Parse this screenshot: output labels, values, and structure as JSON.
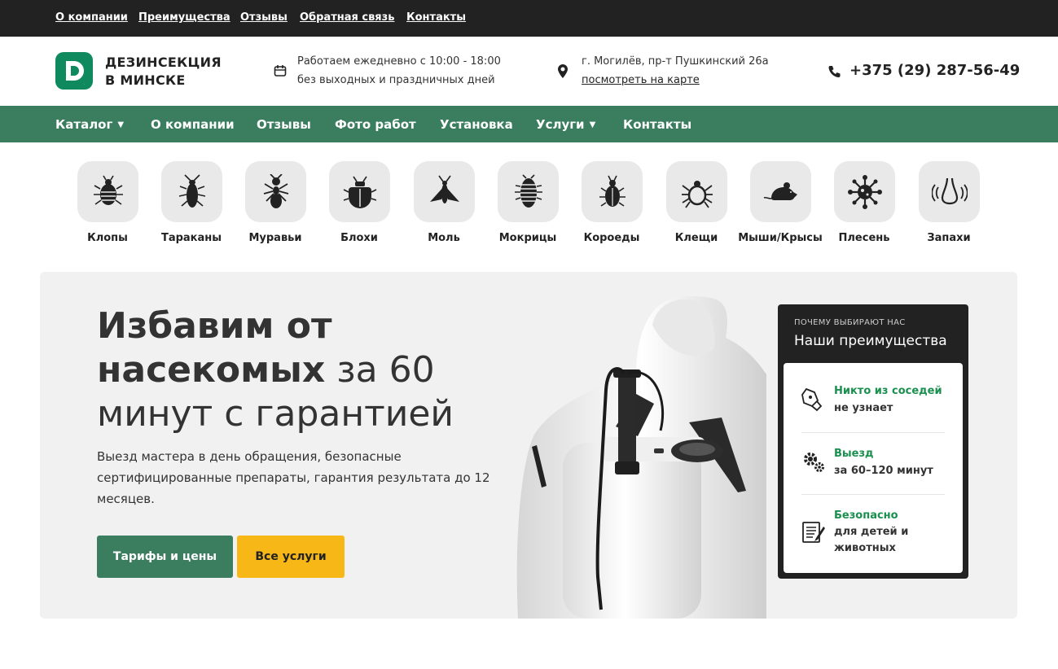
{
  "topnav": [
    "О компании",
    "Преимущества",
    "Отзывы",
    "Обратная связь",
    "Контакты"
  ],
  "header": {
    "logo_letter": "D",
    "logo_line1": "ДЕЗИНСЕКЦИЯ",
    "logo_line2": "В МИНСКЕ",
    "hours_line1": "Работаем ежедневно с 10:00 - 18:00",
    "hours_line2": "без выходных и праздничных дней",
    "address": "г. Могилёв, пр-т Пушкинский 26а",
    "map_link": "посмотреть на карте",
    "phone": "+375 (29) 287-56-49"
  },
  "mainnav": [
    {
      "label": "Каталог",
      "dropdown": true
    },
    {
      "label": "О компании",
      "dropdown": false
    },
    {
      "label": "Отзывы",
      "dropdown": false
    },
    {
      "label": "Фото работ",
      "dropdown": false
    },
    {
      "label": "Установка",
      "dropdown": false
    },
    {
      "label": "Услуги",
      "dropdown": true
    },
    {
      "label": "Контакты",
      "dropdown": false
    }
  ],
  "categories": [
    {
      "label": "Клопы",
      "icon": "bedbug-icon"
    },
    {
      "label": "Тараканы",
      "icon": "cockroach-icon"
    },
    {
      "label": "Муравьи",
      "icon": "ant-icon"
    },
    {
      "label": "Блохи",
      "icon": "flea-icon"
    },
    {
      "label": "Моль",
      "icon": "moth-icon"
    },
    {
      "label": "Мокрицы",
      "icon": "woodlouse-icon"
    },
    {
      "label": "Короеды",
      "icon": "bark-beetle-icon"
    },
    {
      "label": "Клещи",
      "icon": "tick-icon"
    },
    {
      "label": "Мыши/Крысы",
      "icon": "rat-icon"
    },
    {
      "label": "Плесень",
      "icon": "mold-icon"
    },
    {
      "label": "Запахи",
      "icon": "smell-icon"
    }
  ],
  "hero": {
    "title_bold1": "Избавим от",
    "title_bold2": "насекомых",
    "title_rest1": " за 60",
    "title_rest2": "минут с гарантией",
    "description": "Выезд мастера в день обращения, безопасные сертифицированные препараты, гарантия результата до 12 месяцев.",
    "btn_primary": "Тарифы и цены",
    "btn_secondary": "Все услуги"
  },
  "advantages": {
    "subtitle": "ПОЧЕМУ ВЫБИРАЮТ НАС",
    "title": "Наши преимущества",
    "items": [
      {
        "green": "Никто из соседей",
        "black": "не узнает",
        "icon": "pen-icon"
      },
      {
        "green": "Выезд",
        "black": "за 60–120 минут",
        "icon": "gears-icon"
      },
      {
        "green": "Безопасно",
        "black": "для детей и животных",
        "icon": "document-icon"
      }
    ]
  },
  "colors": {
    "brand_green": "#3a7d5f",
    "accent_yellow": "#f7b817",
    "dark": "#222222",
    "highlight_green": "#1a8f4e"
  }
}
